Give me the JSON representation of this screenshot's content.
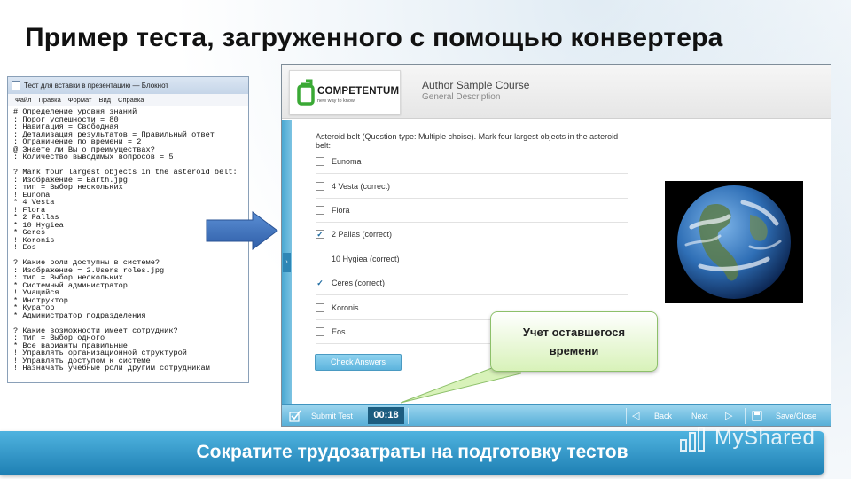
{
  "slide": {
    "title": "Пример теста, загруженного с помощью конвертера",
    "banner": "Сократите трудозатраты на подготовку тестов",
    "watermark": "MyShared"
  },
  "notepad": {
    "title": "Тест для вставки в презентацию — Блокнот",
    "menu": [
      "Файл",
      "Правка",
      "Формат",
      "Вид",
      "Справка"
    ],
    "lines": [
      "# Определение уровня знаний",
      ": Порог успешности = 80",
      ": Навигация = Свободная",
      ": Детализация результатов = Правильный ответ",
      ": Ограничение по времени = 2",
      "@ Знаете ли Вы о преимуществах?",
      ": Количество выводимых вопросов = 5",
      "",
      "? Mark four largest objects in the asteroid belt:",
      ": Изображение = Earth.jpg",
      ": тип = Выбор нескольких",
      "! Eunoma",
      "* 4 Vesta",
      "! Flora",
      "* 2 Pallas",
      "* 10 Hygiea",
      "* Geres",
      "! Koronis",
      "! Eos",
      "",
      "? Какие роли доступны в системе?",
      ": Изображение = 2.Users roles.jpg",
      ": тип = Выбор нескольких",
      "* Системный администратор",
      "! Учащийся",
      "* Инструктор",
      "* Куратор",
      "* Администратор подразделения",
      "",
      "? Какие возможности имеет сотрудник?",
      ": тип = Выбор одного",
      "* Все варианты правильные",
      "! Управлять организационной структурой",
      "! Управлять доступом к системе",
      "! Назначать учебные роли другим сотрудникам"
    ]
  },
  "player": {
    "logo_name": "COMPETENTUM",
    "logo_tagline": "new way to know",
    "course_title": "Author Sample Course",
    "course_subtitle": "General Description",
    "question": "Asteroid belt (Question type: Multiple choise). Mark four largest objects in the asteroid belt:",
    "answers": [
      {
        "label": "Eunoma",
        "checked": false
      },
      {
        "label": "4 Vesta (correct)",
        "checked": false
      },
      {
        "label": "Flora",
        "checked": false
      },
      {
        "label": "2 Pallas (correct)",
        "checked": true
      },
      {
        "label": "10 Hygiea (correct)",
        "checked": false
      },
      {
        "label": "Ceres (correct)",
        "checked": true
      },
      {
        "label": "Koronis",
        "checked": false
      },
      {
        "label": "Eos",
        "checked": false
      }
    ],
    "check_answers_label": "Check Answers",
    "footer": {
      "submit_label": "Submit Test",
      "timer": "00:18",
      "back_label": "Back",
      "next_label": "Next",
      "save_close_label": "Save/Close"
    }
  },
  "callout": {
    "line1": "Учет оставшегося",
    "line2": "времени"
  },
  "colors": {
    "accent_blue": "#4fb3df",
    "banner_dark": "#1f80b4",
    "callout_green": "#d8f2b9",
    "logo_green": "#3aa935"
  }
}
